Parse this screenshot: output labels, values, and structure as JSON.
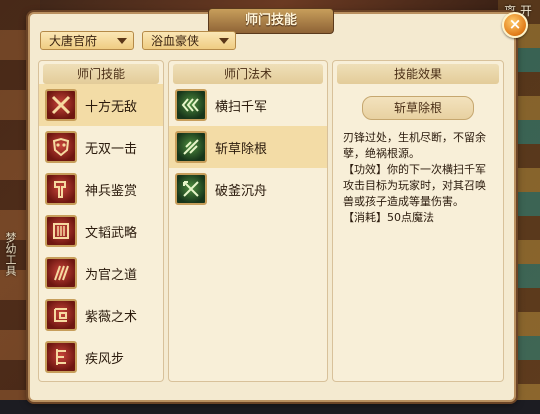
{
  "background": {
    "top_right_text": "离 开",
    "side_text": "梦幼工具"
  },
  "window": {
    "title": "师门技能",
    "close_label": "×"
  },
  "filters": {
    "school": "大唐官府",
    "role": "浴血豪侠"
  },
  "columns": {
    "skills_header": "师门技能",
    "spells_header": "师门法术",
    "effect_header": "技能效果"
  },
  "skills": [
    {
      "label": "十方无敌",
      "icon": "crossed-blades-icon",
      "selected": true
    },
    {
      "label": "无双一击",
      "icon": "demon-mask-icon",
      "selected": false
    },
    {
      "label": "神兵鉴赏",
      "icon": "hammer-icon",
      "selected": false
    },
    {
      "label": "文韬武略",
      "icon": "scroll-icon",
      "selected": false
    },
    {
      "label": "为官之道",
      "icon": "claw-marks-icon",
      "selected": false
    },
    {
      "label": "紫薇之术",
      "icon": "rune-icon",
      "selected": false
    },
    {
      "label": "疾风步",
      "icon": "footstep-icon",
      "selected": false
    }
  ],
  "spells": [
    {
      "label": "横扫千军",
      "icon": "triple-chevron-icon",
      "selected": false
    },
    {
      "label": "斩草除根",
      "icon": "slashing-blade-icon",
      "selected": true
    },
    {
      "label": "破釜沉舟",
      "icon": "crossed-swords-icon",
      "selected": false
    }
  ],
  "effect": {
    "name": "斩草除根",
    "lines": [
      "刃锋过处，生机尽断，不留余孽，绝祸根源。",
      "【功效】你的下一次横扫千军攻击目标为玩家时，对其召唤兽或孩子造成等量伤害。",
      "【消耗】50点魔法"
    ]
  },
  "colors": {
    "panel_bg": "#f4ead0",
    "selected_row": "#f3dca6",
    "close_button": "#e07a18"
  }
}
